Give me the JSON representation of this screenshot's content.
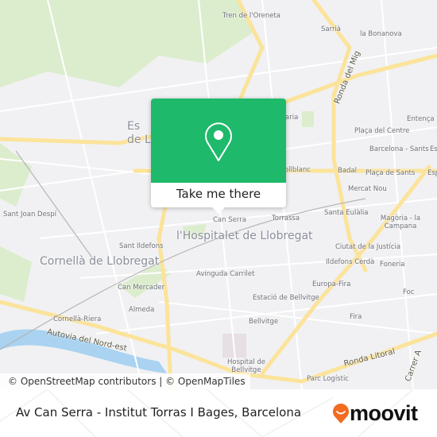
{
  "map": {
    "labels": [
      "Tren de l'Oreneta",
      "Sarrià",
      "la Bonanova",
      "Ronda del Mig",
      "Entença",
      "Plaça del Centre",
      "Barcelona - Sants",
      "Collblanc",
      "Badal",
      "Plaça de Sants",
      "Mercat Nou",
      "Santa Eulàlia",
      "Magòria - la Campana",
      "Can Serra",
      "Torrassa",
      "Sant Joan Despí",
      "Sant Ildefons",
      "Ciutat de la Justícia",
      "Ildefons Cerdà",
      "Foneria",
      "Can Mercader",
      "Avinguda Carrilet",
      "Europa-Fira",
      "Foc",
      "Almeda",
      "Estació de Bellvitge",
      "Cornellà-Riera",
      "Fira",
      "Bellvitge",
      "Hospital de Bellvitge",
      "Parc Logístic",
      "Esp",
      "Esp",
      "aria"
    ],
    "city_labels": [
      "l'Hospitalet de Llobregat",
      "Cornellà de Llobregat",
      "Es de L"
    ],
    "road_labels": [
      "Autovia del Nord-est",
      "Ronda Litoral",
      "Carrer A"
    ],
    "attribution": "© OpenStreetMap contributors | © OpenMapTiles",
    "colors": {
      "land": "#f1f1f3",
      "road": "#fbe59a",
      "park": "#d6ebc4",
      "water": "#a9d3f0"
    }
  },
  "popup": {
    "button_label": "Take me there",
    "icon": "map-pin-icon",
    "color": "#1fb96b"
  },
  "footer": {
    "title": "Av Can Serra - Institut Torras I Bages, Barcelona",
    "logo_text": "moovit",
    "logo_color": "#f26b21"
  }
}
